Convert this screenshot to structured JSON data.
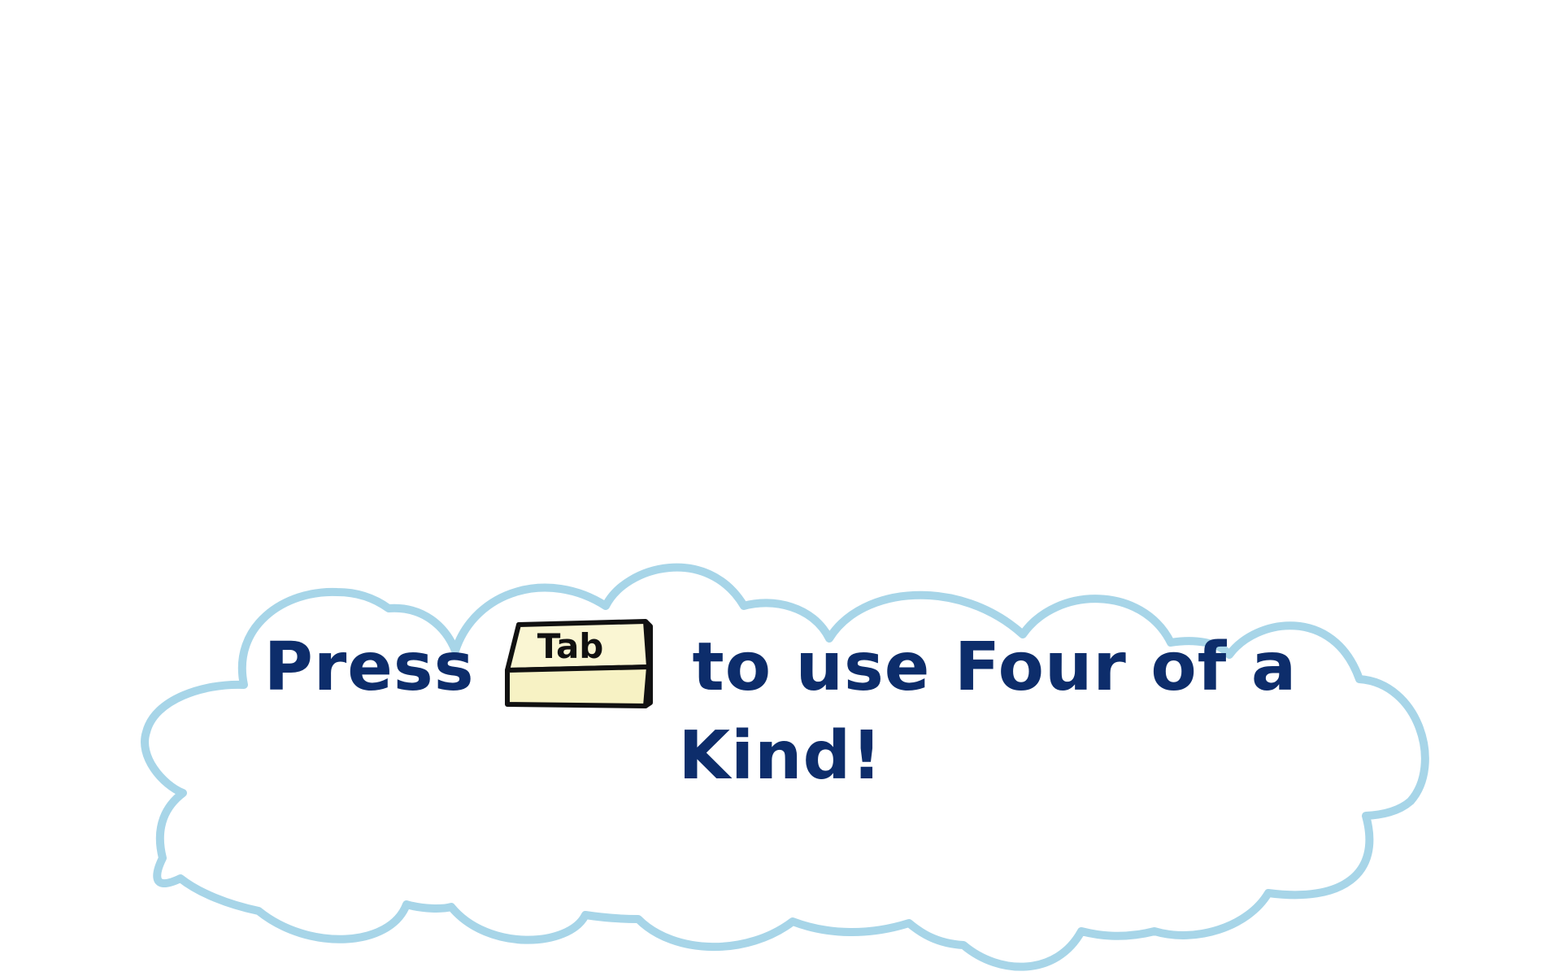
{
  "hint": {
    "word_press": "Press",
    "key_label": "Tab",
    "rest_line1": "to use Four of a",
    "line2": "Kind!"
  },
  "colors": {
    "text": "#0d2d6b",
    "cloud_outline": "#a7d5e8",
    "cloud_fill": "#ffffff",
    "key_face": "#faf6d3",
    "key_outline": "#111111",
    "background": "#ffffff"
  },
  "icons": {
    "cloud": "cloud-bubble",
    "key": "keyboard-key"
  }
}
